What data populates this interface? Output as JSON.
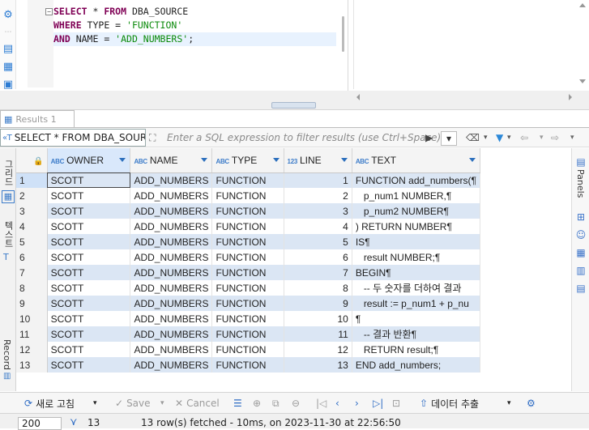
{
  "editor": {
    "lines": [
      [
        {
          "t": "SELECT",
          "c": "kw"
        },
        {
          "t": " * ",
          "c": "op"
        },
        {
          "t": "FROM",
          "c": "kw"
        },
        {
          "t": " DBA_SOURCE",
          "c": "op"
        }
      ],
      [
        {
          "t": "WHERE",
          "c": "kw"
        },
        {
          "t": " TYPE = ",
          "c": "op"
        },
        {
          "t": "'FUNCTION'",
          "c": "str"
        }
      ],
      [
        {
          "t": "AND",
          "c": "kw"
        },
        {
          "t": " NAME = ",
          "c": "op"
        },
        {
          "t": "'ADD_NUMBERS'",
          "c": "str"
        },
        {
          "t": ";",
          "c": "op"
        }
      ]
    ]
  },
  "results_tab": {
    "label": "Results 1"
  },
  "filter": {
    "query_text": "SELECT * FROM DBA_SOURC",
    "placeholder": "Enter a SQL expression to filter results (use Ctrl+Space)"
  },
  "grid": {
    "columns": [
      {
        "label": "OWNER",
        "type": "ABC"
      },
      {
        "label": "NAME",
        "type": "ABC"
      },
      {
        "label": "TYPE",
        "type": "ABC"
      },
      {
        "label": "LINE",
        "type": "123"
      },
      {
        "label": "TEXT",
        "type": "ABC"
      }
    ],
    "rows": [
      [
        "1",
        "SCOTT",
        "ADD_NUMBERS",
        "FUNCTION",
        "1",
        "FUNCTION add_numbers(¶"
      ],
      [
        "2",
        "SCOTT",
        "ADD_NUMBERS",
        "FUNCTION",
        "2",
        "   p_num1 NUMBER,¶"
      ],
      [
        "3",
        "SCOTT",
        "ADD_NUMBERS",
        "FUNCTION",
        "3",
        "   p_num2 NUMBER¶"
      ],
      [
        "4",
        "SCOTT",
        "ADD_NUMBERS",
        "FUNCTION",
        "4",
        ") RETURN NUMBER¶"
      ],
      [
        "5",
        "SCOTT",
        "ADD_NUMBERS",
        "FUNCTION",
        "5",
        "IS¶"
      ],
      [
        "6",
        "SCOTT",
        "ADD_NUMBERS",
        "FUNCTION",
        "6",
        "   result NUMBER;¶"
      ],
      [
        "7",
        "SCOTT",
        "ADD_NUMBERS",
        "FUNCTION",
        "7",
        "BEGIN¶"
      ],
      [
        "8",
        "SCOTT",
        "ADD_NUMBERS",
        "FUNCTION",
        "8",
        "   -- 두 숫자를 더하여 결과"
      ],
      [
        "9",
        "SCOTT",
        "ADD_NUMBERS",
        "FUNCTION",
        "9",
        "   result := p_num1 + p_nu"
      ],
      [
        "10",
        "SCOTT",
        "ADD_NUMBERS",
        "FUNCTION",
        "10",
        "¶"
      ],
      [
        "11",
        "SCOTT",
        "ADD_NUMBERS",
        "FUNCTION",
        "11",
        "   -- 결과 반환¶"
      ],
      [
        "12",
        "SCOTT",
        "ADD_NUMBERS",
        "FUNCTION",
        "12",
        "   RETURN result;¶"
      ],
      [
        "13",
        "SCOTT",
        "ADD_NUMBERS",
        "FUNCTION",
        "13",
        "END add_numbers;"
      ]
    ]
  },
  "side_tabs": {
    "grid": "그리드",
    "text": "텍스트",
    "record": "Record",
    "panels": "Panels"
  },
  "bottom": {
    "refresh": "새로 고침",
    "save": "Save",
    "cancel": "Cancel",
    "export": "데이터 추출"
  },
  "status": {
    "fetch_size": "200",
    "row_count": "13",
    "message": "13 row(s) fetched - 10ms, on 2023-11-30 at 22:56:50"
  },
  "colors": {
    "accent": "#2e6cc4",
    "odd_row": "#dbe6f4",
    "keyword": "#7f0055",
    "string": "#0a8a0a"
  }
}
